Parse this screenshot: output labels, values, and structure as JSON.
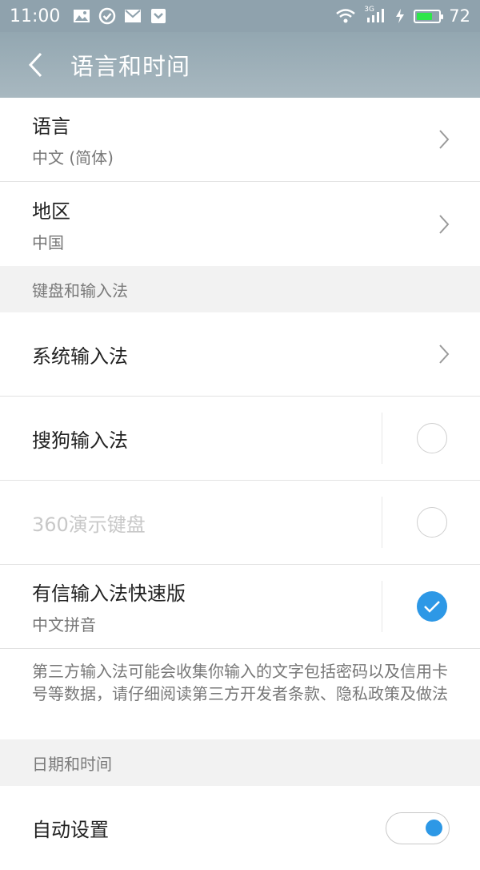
{
  "status_bar": {
    "time": "11:00",
    "network_label": "3G",
    "battery_percent": "72",
    "battery_level": 0.72,
    "icons": [
      "image-icon",
      "check-circle-icon",
      "mail-icon",
      "shield-icon",
      "wifi-icon",
      "signal-icon",
      "charging-icon",
      "battery-icon"
    ]
  },
  "header": {
    "title": "语言和时间",
    "back_icon": "chevron-left-icon"
  },
  "language": {
    "title": "语言",
    "value": "中文 (简体)"
  },
  "region": {
    "title": "地区",
    "value": "中国"
  },
  "keyboard_section": {
    "header": "键盘和输入法",
    "system_ime": {
      "title": "系统输入法"
    },
    "sogou": {
      "title": "搜狗输入法",
      "checked": false
    },
    "demo360": {
      "title": "360演示键盘",
      "checked": false,
      "disabled": true
    },
    "youxin": {
      "title": "有信输入法快速版",
      "subtitle": "中文拼音",
      "checked": true
    },
    "notice": "第三方输入法可能会收集你输入的文字包括密码以及信用卡号等数据，请仔细阅读第三方开发者条款、隐私政策及做法"
  },
  "datetime_section": {
    "header": "日期和时间",
    "auto": {
      "title": "自动设置",
      "on": true
    }
  },
  "colors": {
    "accent": "#2d98e6",
    "title_bar": "#9aaeb8",
    "battery_fill": "#2ee64a"
  }
}
